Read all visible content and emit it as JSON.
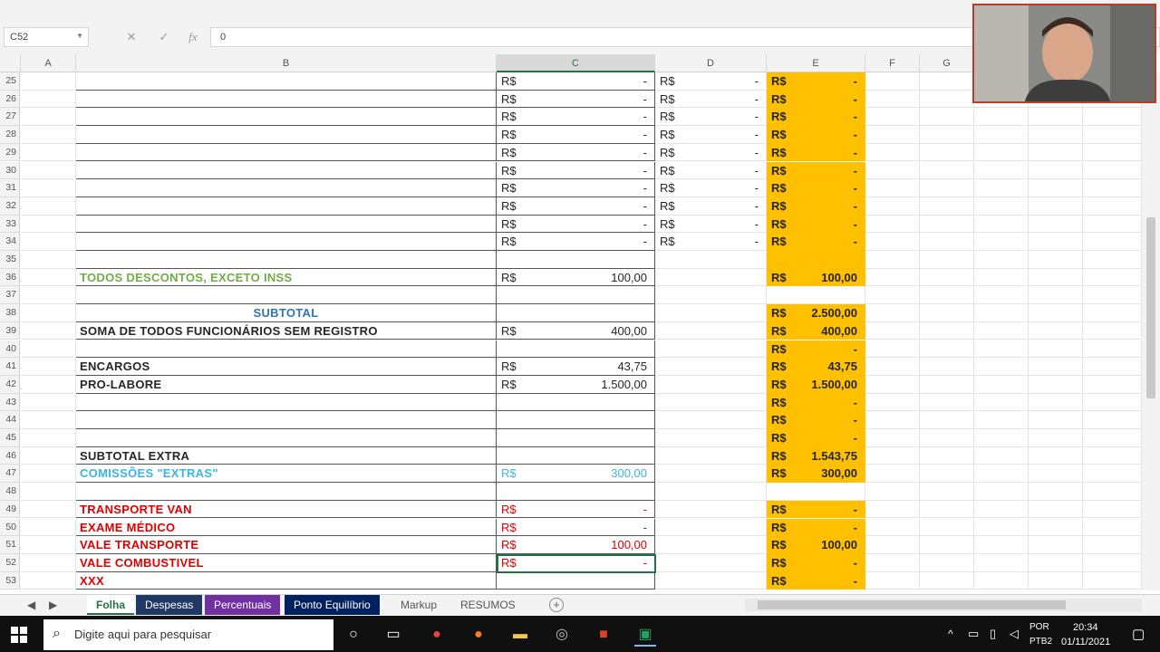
{
  "formula_bar": {
    "name_box": "C52",
    "formula": "0"
  },
  "columns": [
    "A",
    "B",
    "C",
    "D",
    "E",
    "F",
    "G"
  ],
  "selected_column": "C",
  "currency": "R$",
  "rows": [
    {
      "n": "25",
      "b": "",
      "c_cur": "R$",
      "c": "-",
      "d_cur": "R$",
      "d": "-",
      "e_cur": "R$",
      "e": "-",
      "gold": true
    },
    {
      "n": "26",
      "b": "",
      "c_cur": "R$",
      "c": "-",
      "d_cur": "R$",
      "d": "-",
      "e_cur": "R$",
      "e": "-",
      "gold": true
    },
    {
      "n": "27",
      "b": "",
      "c_cur": "R$",
      "c": "-",
      "d_cur": "R$",
      "d": "-",
      "e_cur": "R$",
      "e": "-",
      "gold": true
    },
    {
      "n": "28",
      "b": "",
      "c_cur": "R$",
      "c": "-",
      "d_cur": "R$",
      "d": "-",
      "e_cur": "R$",
      "e": "-",
      "gold": true
    },
    {
      "n": "29",
      "b": "",
      "c_cur": "R$",
      "c": "-",
      "d_cur": "R$",
      "d": "-",
      "e_cur": "R$",
      "e": "-",
      "gold": true
    },
    {
      "n": "30",
      "b": "",
      "c_cur": "R$",
      "c": "-",
      "d_cur": "R$",
      "d": "-",
      "e_cur": "R$",
      "e": "-",
      "gold": true
    },
    {
      "n": "31",
      "b": "",
      "c_cur": "R$",
      "c": "-",
      "d_cur": "R$",
      "d": "-",
      "e_cur": "R$",
      "e": "-",
      "gold": true
    },
    {
      "n": "32",
      "b": "",
      "c_cur": "R$",
      "c": "-",
      "d_cur": "R$",
      "d": "-",
      "e_cur": "R$",
      "e": "-",
      "gold": true
    },
    {
      "n": "33",
      "b": "",
      "c_cur": "R$",
      "c": "-",
      "d_cur": "R$",
      "d": "-",
      "e_cur": "R$",
      "e": "-",
      "gold": true
    },
    {
      "n": "34",
      "b": "",
      "c_cur": "R$",
      "c": "-",
      "d_cur": "R$",
      "d": "-",
      "e_cur": "R$",
      "e": "-",
      "gold": true
    },
    {
      "n": "35",
      "b": "",
      "c_cur": "",
      "c": "",
      "d_cur": "",
      "d": "",
      "e_cur": "",
      "e": "",
      "gold": true
    },
    {
      "n": "36",
      "b": "TODOS DESCONTOS, EXCETO INSS",
      "color": "green",
      "c_cur": "R$",
      "c": "100,00",
      "d_cur": "",
      "d": "",
      "e_cur": "R$",
      "e": "100,00",
      "gold": true
    },
    {
      "n": "37",
      "b": "",
      "c_cur": "",
      "c": "",
      "d_cur": "",
      "d": "",
      "e_cur": "",
      "e": "",
      "gold": false
    },
    {
      "n": "38",
      "b": "SUBTOTAL",
      "color": "blue",
      "center": true,
      "c_cur": "",
      "c": "",
      "d_cur": "",
      "d": "",
      "e_cur": "R$",
      "e": "2.500,00",
      "gold": true
    },
    {
      "n": "39",
      "b": "SOMA DE TODOS FUNCIONÁRIOS SEM REGISTRO",
      "color": "dark",
      "c_cur": "R$",
      "c": "400,00",
      "d_cur": "",
      "d": "",
      "e_cur": "R$",
      "e": "400,00",
      "gold": true
    },
    {
      "n": "40",
      "b": "",
      "c_cur": "",
      "c": "",
      "d_cur": "",
      "d": "",
      "e_cur": "R$",
      "e": "-",
      "gold": true
    },
    {
      "n": "41",
      "b": "ENCARGOS",
      "color": "dark",
      "c_cur": "R$",
      "c": "43,75",
      "d_cur": "",
      "d": "",
      "e_cur": "R$",
      "e": "43,75",
      "gold": true
    },
    {
      "n": "42",
      "b": "PRO-LABORE",
      "color": "dark",
      "c_cur": "R$",
      "c": "1.500,00",
      "d_cur": "",
      "d": "",
      "e_cur": "R$",
      "e": "1.500,00",
      "gold": true
    },
    {
      "n": "43",
      "b": "",
      "c_cur": "",
      "c": "",
      "d_cur": "",
      "d": "",
      "e_cur": "R$",
      "e": "-",
      "gold": true
    },
    {
      "n": "44",
      "b": "",
      "c_cur": "",
      "c": "",
      "d_cur": "",
      "d": "",
      "e_cur": "R$",
      "e": "-",
      "gold": true
    },
    {
      "n": "45",
      "b": "",
      "c_cur": "",
      "c": "",
      "d_cur": "",
      "d": "",
      "e_cur": "R$",
      "e": "-",
      "gold": true
    },
    {
      "n": "46",
      "b": "SUBTOTAL EXTRA",
      "color": "dark",
      "c_cur": "",
      "c": "",
      "d_cur": "",
      "d": "",
      "e_cur": "R$",
      "e": "1.543,75",
      "gold": true
    },
    {
      "n": "47",
      "b": "COMISSÕES \"EXTRAS\"",
      "color": "cyan",
      "c_cur": "R$",
      "c": "300,00",
      "c_color": "cyan",
      "d_cur": "",
      "d": "",
      "e_cur": "R$",
      "e": "300,00",
      "gold": true
    },
    {
      "n": "48",
      "b": "",
      "c_cur": "",
      "c": "",
      "d_cur": "",
      "d": "",
      "e_cur": "",
      "e": "",
      "gold": false
    },
    {
      "n": "49",
      "b": "TRANSPORTE VAN",
      "color": "red",
      "c_cur": "R$",
      "c": "-",
      "c_color": "red",
      "d_cur": "",
      "d": "",
      "e_cur": "R$",
      "e": "-",
      "gold": true
    },
    {
      "n": "50",
      "b": "EXAME MÉDICO",
      "color": "red",
      "c_cur": "R$",
      "c": "-",
      "c_color": "red",
      "d_cur": "",
      "d": "",
      "e_cur": "R$",
      "e": "-",
      "gold": true
    },
    {
      "n": "51",
      "b": "VALE TRANSPORTE",
      "color": "red",
      "c_cur": "R$",
      "c": "100,00",
      "c_color": "red",
      "d_cur": "",
      "d": "",
      "e_cur": "R$",
      "e": "100,00",
      "gold": true
    },
    {
      "n": "52",
      "b": "VALE COMBUSTIVEL",
      "color": "red",
      "c_cur": "R$",
      "c": "-",
      "c_color": "red",
      "d_cur": "",
      "d": "",
      "e_cur": "R$",
      "e": "-",
      "gold": true
    },
    {
      "n": "53",
      "b": "XXX",
      "color": "red",
      "c_cur": "",
      "c": "",
      "d_cur": "",
      "d": "",
      "e_cur": "R$",
      "e": "-",
      "gold": true
    }
  ],
  "sheet_tabs": [
    {
      "label": "Folha",
      "style": "active"
    },
    {
      "label": "Despesas",
      "style": "t-navy"
    },
    {
      "label": "Percentuais",
      "style": "t-purple"
    },
    {
      "label": "Ponto Equilíbrio",
      "style": "t-dblue"
    },
    {
      "label": "Markup",
      "style": "plain"
    },
    {
      "label": "RESUMOS",
      "style": "plain"
    }
  ],
  "taskbar": {
    "search_placeholder": "Digite aqui para pesquisar",
    "lang_top": "POR",
    "lang_bottom": "PTB2",
    "time": "20:34",
    "date": "01/11/2021"
  },
  "colors": {
    "gold": "#ffc000",
    "excel_green": "#217346",
    "red_text": "#e00000",
    "green_text": "#70ad47",
    "blue_text": "#2e75b6",
    "cyan_text": "#3cb4e5"
  }
}
